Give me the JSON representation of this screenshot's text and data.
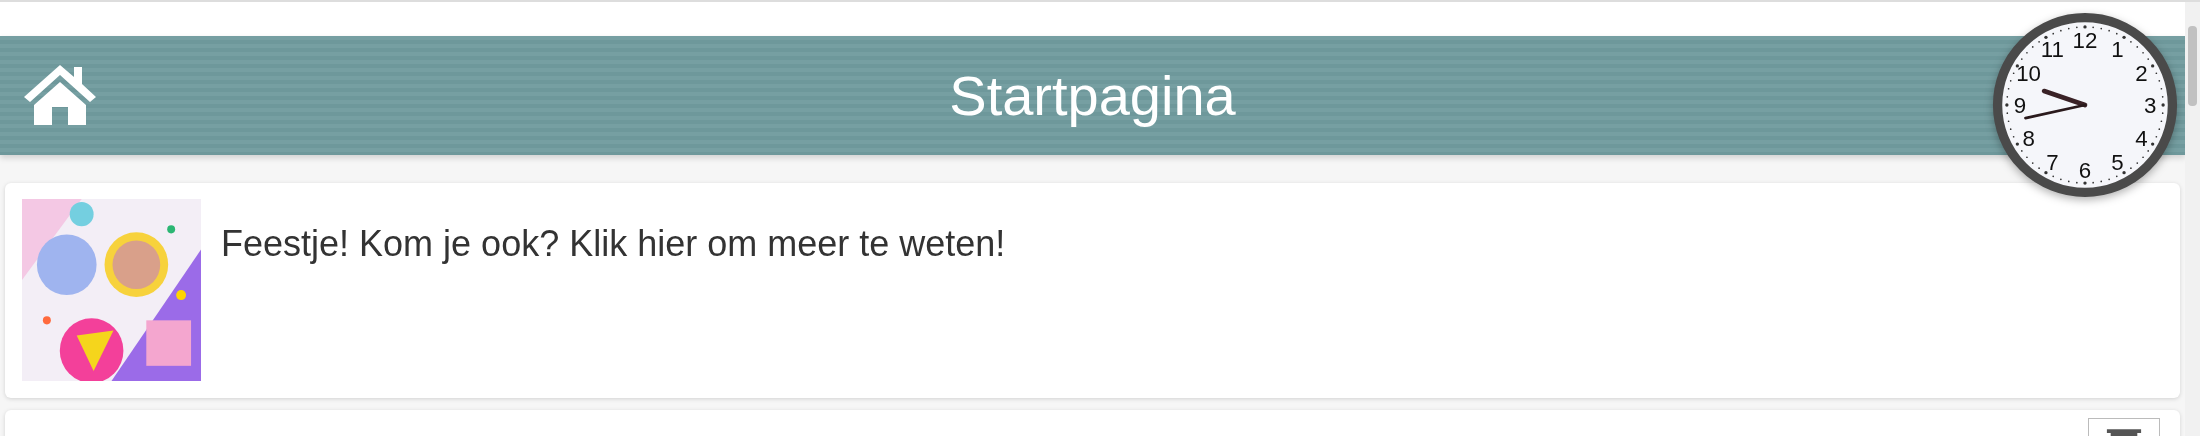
{
  "header": {
    "title": "Startpagina"
  },
  "clock": {
    "numerals": [
      "12",
      "11",
      "1",
      "10",
      "2",
      "9",
      "3",
      "8",
      "4",
      "7",
      "5",
      "6"
    ]
  },
  "cards": [
    {
      "kind": "picture",
      "text": "Feestje! Kom je ook? Klik hier om meer te weten!"
    },
    {
      "kind": "action"
    }
  ]
}
